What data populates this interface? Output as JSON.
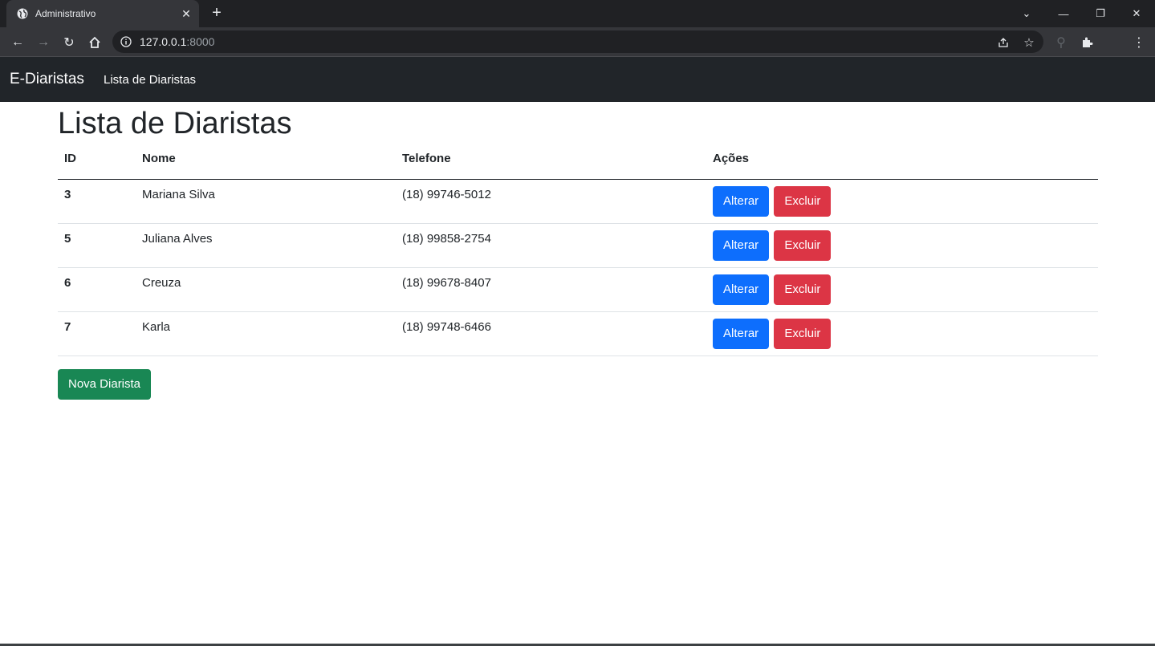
{
  "browser": {
    "tab_title": "Administrativo",
    "url_host": "127.0.0.1",
    "url_port": ":8000"
  },
  "navbar": {
    "brand": "E-Diaristas",
    "link": "Lista de Diaristas"
  },
  "page": {
    "title": "Lista de Diaristas",
    "columns": [
      "ID",
      "Nome",
      "Telefone",
      "Ações"
    ],
    "rows": [
      {
        "id": "3",
        "nome": "Mariana Silva",
        "telefone": "(18) 99746-5012"
      },
      {
        "id": "5",
        "nome": "Juliana Alves",
        "telefone": "(18) 99858-2754"
      },
      {
        "id": "6",
        "nome": "Creuza",
        "telefone": "(18) 99678-8407"
      },
      {
        "id": "7",
        "nome": "Karla",
        "telefone": "(18) 99748-6466"
      }
    ],
    "edit_label": "Alterar",
    "delete_label": "Excluir",
    "new_label": "Nova Diarista"
  },
  "colors": {
    "primary": "#0d6efd",
    "danger": "#dc3545",
    "success": "#198754",
    "navbar": "#212529"
  }
}
